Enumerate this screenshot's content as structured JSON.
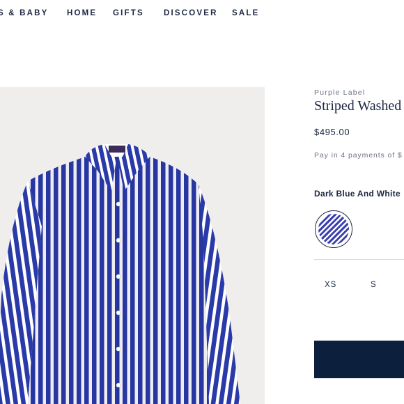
{
  "nav": {
    "items": [
      "S & BABY",
      "HOME",
      "GIFTS",
      "DISCOVER",
      "SALE"
    ]
  },
  "product": {
    "brand": "Purple Label",
    "title": "Striped Washed",
    "price": "$495.00",
    "installments": "Pay in 4 payments of $",
    "color_name": "Dark Blue And White",
    "swatch_colors": [
      "#3a3fb0",
      "#ffffff"
    ],
    "sizes": [
      "XS",
      "S"
    ]
  },
  "colors": {
    "shirt_stripe": "#2a3aa8",
    "background": "#efeeec",
    "button": "#0c1f3d",
    "text": "#1b2741"
  },
  "icons": {
    "product_image": "striped-shirt"
  }
}
